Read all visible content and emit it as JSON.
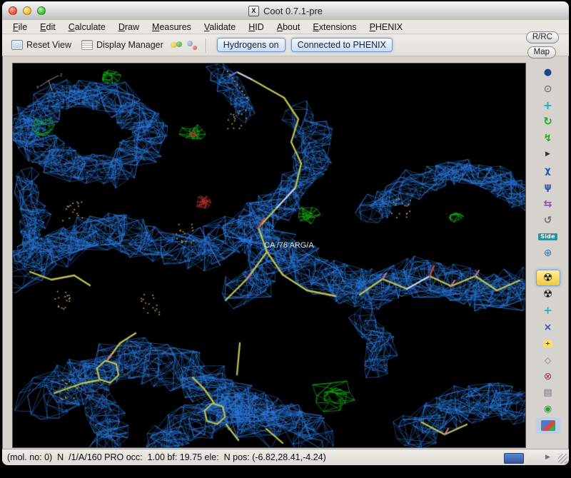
{
  "window": {
    "title": "Coot 0.7.1-pre",
    "title_icon": "X"
  },
  "menubar": {
    "items": [
      "File",
      "Edit",
      "Calculate",
      "Draw",
      "Measures",
      "Validate",
      "HID",
      "About",
      "Extensions",
      "PHENIX"
    ]
  },
  "toolbar": {
    "reset_view": "Reset View",
    "display_manager": "Display Manager",
    "hydrogens_toggle": "Hydrogens on",
    "phenix_status": "Connected to PHENIX"
  },
  "right_panel": {
    "rrc_button": "R/RC",
    "map_button": "Map",
    "icons": [
      {
        "name": "sphere-icon",
        "glyph": "●",
        "color": "#23408f",
        "size": 13
      },
      {
        "name": "clock-icon",
        "glyph": "⊙",
        "color": "#5a5a5a",
        "size": 14
      },
      {
        "name": "translate-icon",
        "glyph": "+",
        "color": "#12b5c9",
        "size": 16,
        "bold": true
      },
      {
        "name": "rotate-icon",
        "glyph": "↻",
        "color": "#2f9e2f",
        "size": 15,
        "bold": true
      },
      {
        "name": "torsion-icon",
        "glyph": "↯",
        "color": "#2f9e2f",
        "size": 14,
        "bold": true
      },
      {
        "name": "expand-arrow-icon",
        "glyph": "▶",
        "color": "#333333",
        "size": 9
      },
      {
        "name": "rotamer-icon",
        "glyph": "χ",
        "color": "#3a55a8",
        "size": 13,
        "bold": true
      },
      {
        "name": "chi-angles-icon",
        "glyph": "ψ",
        "color": "#3a55a8",
        "size": 13,
        "bold": true
      },
      {
        "name": "flip-icon",
        "glyph": "⇆",
        "color": "#8a4aa8",
        "size": 14,
        "bold": true
      },
      {
        "name": "rotate-translate-icon",
        "glyph": "↺",
        "color": "#6e6e6e",
        "size": 14,
        "bold": true
      },
      {
        "name": "sidechain-180-icon",
        "kind": "text",
        "glyph": "Side",
        "color": "#ffffff",
        "bg": "#2f8f9e"
      },
      {
        "name": "terminal-residue-icon",
        "glyph": "⊕",
        "color": "#4a6ab0",
        "size": 14
      },
      {
        "name": "real-space-refine-icon",
        "glyph": "☢",
        "color": "#111111",
        "size": 15,
        "active": true,
        "gap": true
      },
      {
        "name": "regularize-icon",
        "glyph": "☢",
        "color": "#111111",
        "size": 15
      },
      {
        "name": "rigid-body-icon",
        "glyph": "+",
        "color": "#12b5c9",
        "size": 15,
        "bold": true
      },
      {
        "name": "mutate-icon",
        "glyph": "×",
        "color": "#3a55a8",
        "size": 14,
        "bold": true
      },
      {
        "name": "add-atom-icon",
        "kind": "text",
        "glyph": "+",
        "color": "#333333",
        "bg": "#ffdf6a"
      },
      {
        "name": "pointer-atom-icon",
        "glyph": "◇",
        "color": "#7a7a7a",
        "size": 12
      },
      {
        "name": "delete-icon",
        "glyph": "⊗",
        "color": "#a33c3c",
        "size": 14
      },
      {
        "name": "cylinder-icon",
        "glyph": "▤",
        "color": "#6a7588",
        "size": 13
      },
      {
        "name": "blob-icon",
        "glyph": "◉",
        "color": "#2f9e2f",
        "size": 13
      },
      {
        "name": "image-icon",
        "kind": "flag",
        "sel": true
      }
    ],
    "scroll_right": "▶"
  },
  "scene": {
    "atom_label": "CA /76 ARG/A",
    "colors": {
      "background": "#000000",
      "density": "#2b7de6",
      "positive_diff": "#12b412",
      "negative_diff": "#c03030",
      "sticks": "#c2c24e",
      "sticks_pale": "#ccd4e2",
      "nitrogen": "#5a78d8",
      "oxygen": "#cc4444",
      "pink_tick": "#e0709a",
      "dots": "#bfae45",
      "axes": "#8a9aa8",
      "label": "#e3e3e3"
    }
  },
  "statusbar": {
    "text": "(mol. no: 0)  N  /1/A/160 PRO occ:  1.00 bf: 19.75 ele:  N pos: (-6.82,28.41,-4.24)"
  }
}
